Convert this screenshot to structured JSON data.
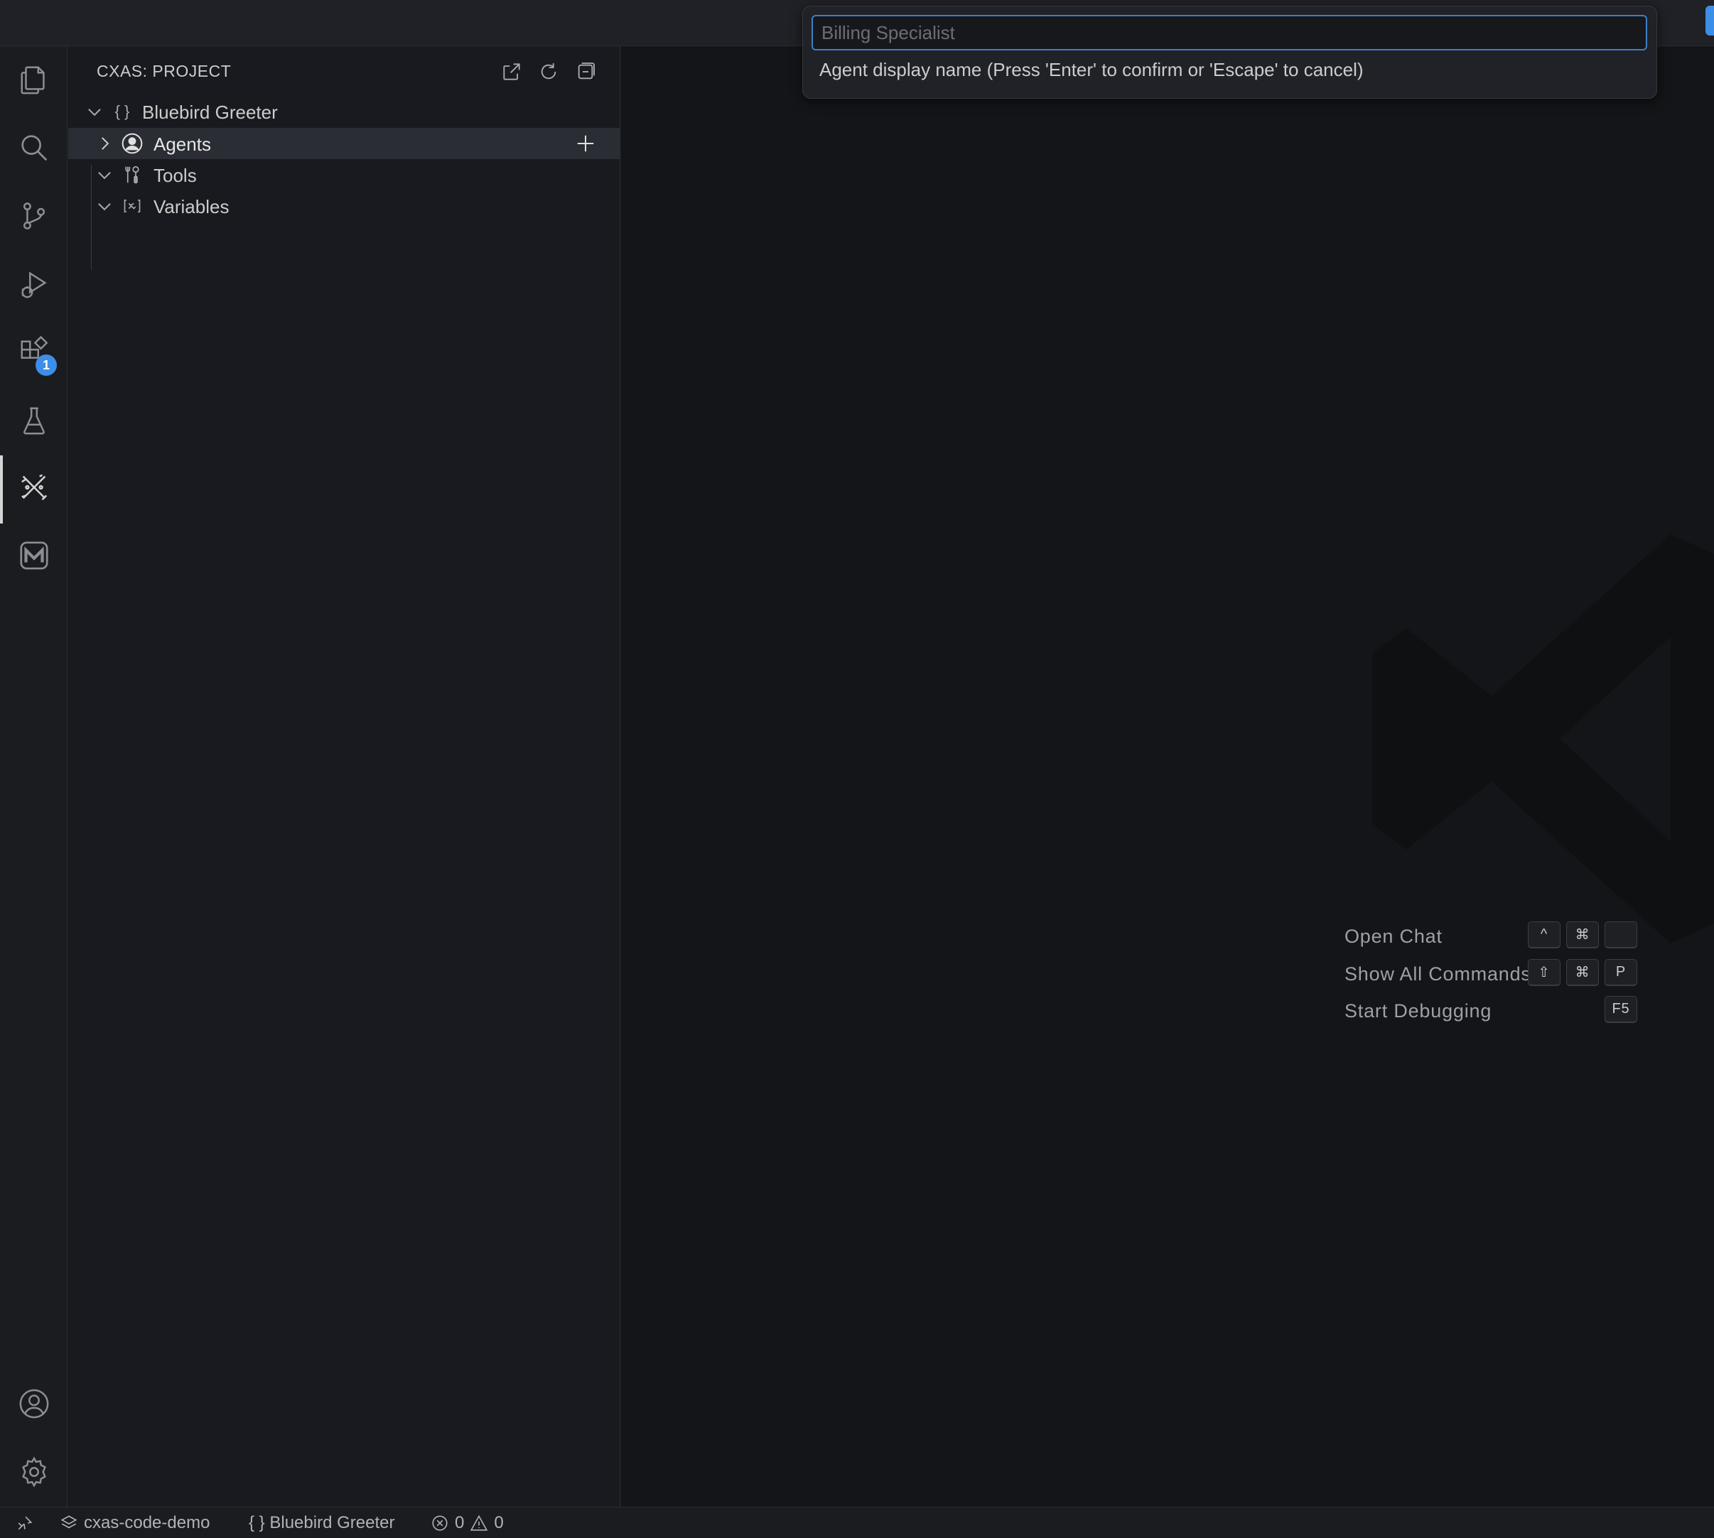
{
  "sidebar": {
    "title": "CXAS: PROJECT",
    "project_name": "Bluebird Greeter",
    "items": [
      {
        "label": "Agents",
        "icon": "person-circle-icon",
        "expanded": false
      },
      {
        "label": "Tools",
        "icon": "tools-icon",
        "expanded": true
      },
      {
        "label": "Variables",
        "icon": "variable-icon",
        "expanded": true
      }
    ]
  },
  "activity_bar": {
    "extensions_badge": "1"
  },
  "quick_input": {
    "placeholder": "Billing Specialist",
    "value": "",
    "message": "Agent display name (Press 'Enter' to confirm or 'Escape' to cancel)"
  },
  "editor": {
    "shortcuts": [
      {
        "label": "Open Chat",
        "keys": [
          "^",
          "⌘",
          ""
        ]
      },
      {
        "label": "Show All Commands",
        "keys": [
          "⇧",
          "⌘",
          "P"
        ]
      },
      {
        "label": "Start Debugging",
        "keys": [
          "F5"
        ]
      }
    ]
  },
  "status_bar": {
    "workspace": "cxas-code-demo",
    "project": "{ } Bluebird Greeter",
    "errors": "0",
    "warnings": "0"
  },
  "colors": {
    "accent": "#3d8ee8",
    "focus_border": "#3d7fc8",
    "background": "#181a1f",
    "editor_background": "#141518"
  }
}
